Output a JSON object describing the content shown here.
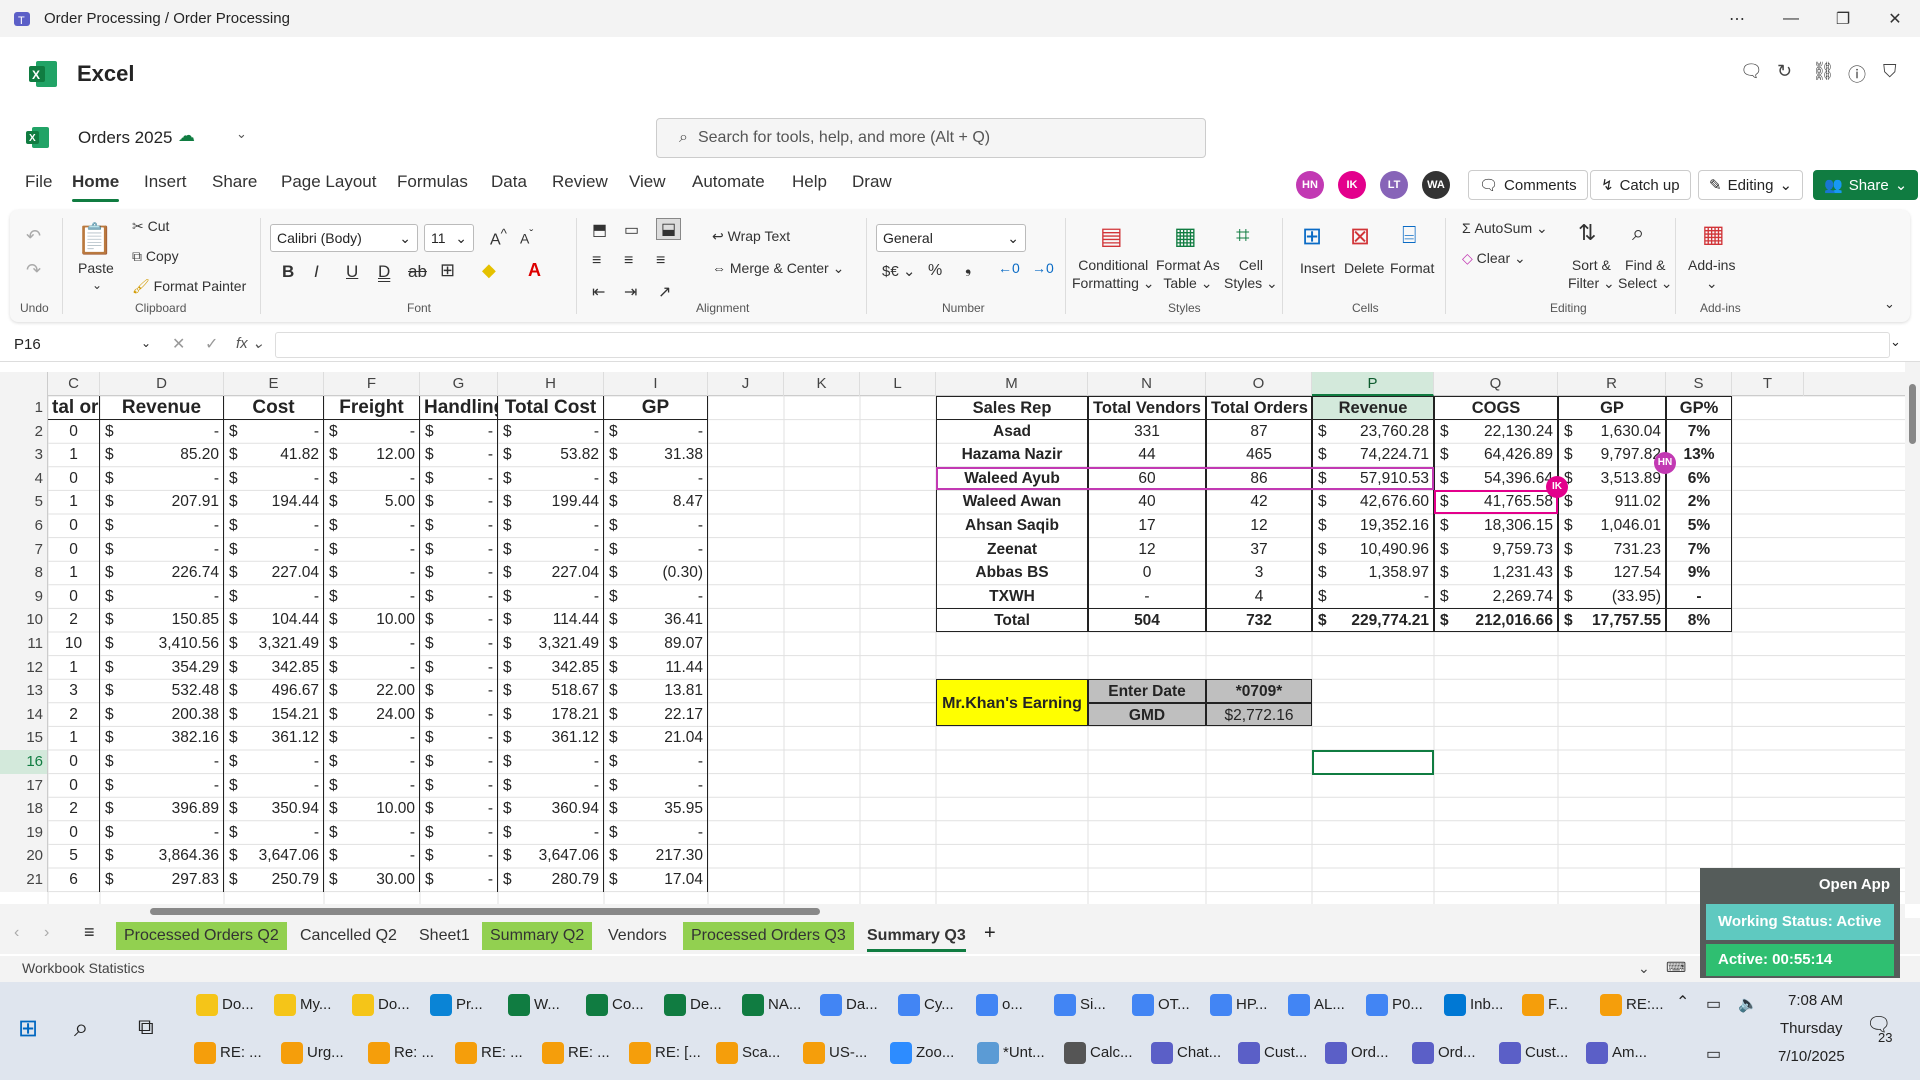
{
  "window": {
    "title": "Order Processing / Order Processing"
  },
  "app": {
    "name": "Excel",
    "doc_name": "Orders 2025"
  },
  "search": {
    "placeholder": "Search for tools, help, and more (Alt + Q)"
  },
  "tabs": [
    "File",
    "Home",
    "Insert",
    "Share",
    "Page Layout",
    "Formulas",
    "Data",
    "Review",
    "View",
    "Automate",
    "Help",
    "Draw"
  ],
  "tab_active": "Home",
  "avatars": [
    {
      "t": "HN",
      "c": "#c239b3"
    },
    {
      "t": "IK",
      "c": "#e3008c"
    },
    {
      "t": "LT",
      "c": "#8764b8"
    },
    {
      "t": "WA",
      "c": "#333333"
    }
  ],
  "actions": {
    "comments": "Comments",
    "catchup": "Catch up",
    "editing": "Editing",
    "share": "Share"
  },
  "ribbon": {
    "undo": "Undo",
    "paste": "Paste",
    "cut": "Cut",
    "copy": "Copy",
    "format_painter": "Format Painter",
    "clipboard": "Clipboard",
    "font_name": "Calibri (Body)",
    "font_size": "11",
    "font": "Font",
    "wrap": "Wrap Text",
    "merge": "Merge & Center",
    "alignment": "Alignment",
    "numfmt": "General",
    "number": "Number",
    "cond": "Conditional",
    "cond2": "Formatting",
    "fat": "Format As",
    "fat2": "Table",
    "cs": "Cell",
    "cs2": "Styles",
    "styles": "Styles",
    "insert": "Insert",
    "delete": "Delete",
    "format": "Format",
    "cells": "Cells",
    "autosum": "AutoSum",
    "clear": "Clear",
    "sort": "Sort &",
    "sort2": "Filter",
    "find": "Find &",
    "find2": "Select",
    "editing": "Editing",
    "addins": "Add-ins",
    "addins_grp": "Add-ins"
  },
  "namebox": "P16",
  "columns": [
    "C",
    "D",
    "E",
    "F",
    "G",
    "H",
    "I",
    "J",
    "K",
    "L",
    "M",
    "N",
    "O",
    "P",
    "Q",
    "R",
    "S",
    "T"
  ],
  "rows": [
    "1",
    "2",
    "3",
    "4",
    "5",
    "6",
    "7",
    "8",
    "9",
    "10",
    "11",
    "12",
    "13",
    "14",
    "15",
    "16",
    "17",
    "18",
    "19",
    "20",
    "21"
  ],
  "left_headers": [
    "tal orders",
    "Revenue",
    "Cost",
    "Freight",
    "Handling",
    "Total Cost",
    "GP"
  ],
  "left_rows": [
    [
      "0",
      "-",
      "-",
      "-",
      "-",
      "-",
      "-"
    ],
    [
      "1",
      "85.20",
      "41.82",
      "12.00",
      "-",
      "53.82",
      "31.38"
    ],
    [
      "0",
      "-",
      "-",
      "-",
      "-",
      "-",
      "-"
    ],
    [
      "1",
      "207.91",
      "194.44",
      "5.00",
      "-",
      "199.44",
      "8.47"
    ],
    [
      "0",
      "-",
      "-",
      "-",
      "-",
      "-",
      "-"
    ],
    [
      "0",
      "-",
      "-",
      "-",
      "-",
      "-",
      "-"
    ],
    [
      "1",
      "226.74",
      "227.04",
      "-",
      "-",
      "227.04",
      "(0.30)"
    ],
    [
      "0",
      "-",
      "-",
      "-",
      "-",
      "-",
      "-"
    ],
    [
      "2",
      "150.85",
      "104.44",
      "10.00",
      "-",
      "114.44",
      "36.41"
    ],
    [
      "10",
      "3,410.56",
      "3,321.49",
      "-",
      "-",
      "3,321.49",
      "89.07"
    ],
    [
      "1",
      "354.29",
      "342.85",
      "-",
      "-",
      "342.85",
      "11.44"
    ],
    [
      "3",
      "532.48",
      "496.67",
      "22.00",
      "-",
      "518.67",
      "13.81"
    ],
    [
      "2",
      "200.38",
      "154.21",
      "24.00",
      "-",
      "178.21",
      "22.17"
    ],
    [
      "1",
      "382.16",
      "361.12",
      "-",
      "-",
      "361.12",
      "21.04"
    ],
    [
      "0",
      "-",
      "-",
      "-",
      "-",
      "-",
      "-"
    ],
    [
      "0",
      "-",
      "-",
      "-",
      "-",
      "-",
      "-"
    ],
    [
      "2",
      "396.89",
      "350.94",
      "10.00",
      "-",
      "360.94",
      "35.95"
    ],
    [
      "0",
      "-",
      "-",
      "-",
      "-",
      "-",
      "-"
    ],
    [
      "5",
      "3,864.36",
      "3,647.06",
      "-",
      "-",
      "3,647.06",
      "217.30"
    ],
    [
      "6",
      "297.83",
      "250.79",
      "30.00",
      "-",
      "280.79",
      "17.04"
    ]
  ],
  "right_headers": [
    "Sales Rep",
    "Total Vendors",
    "Total Orders",
    "Revenue",
    "COGS",
    "GP",
    "GP%"
  ],
  "right_rows": [
    [
      "Asad",
      "331",
      "87",
      "23,760.28",
      "22,130.24",
      "1,630.04",
      "7%"
    ],
    [
      "Hazama Nazir",
      "44",
      "465",
      "74,224.71",
      "64,426.89",
      "9,797.82",
      "13%"
    ],
    [
      "Waleed Ayub",
      "60",
      "86",
      "57,910.53",
      "54,396.64",
      "3,513.89",
      "6%"
    ],
    [
      "Waleed Awan",
      "40",
      "42",
      "42,676.60",
      "41,765.58",
      "911.02",
      "2%"
    ],
    [
      "Ahsan Saqib",
      "17",
      "12",
      "19,352.16",
      "18,306.15",
      "1,046.01",
      "5%"
    ],
    [
      "Zeenat",
      "12",
      "37",
      "10,490.96",
      "9,759.73",
      "731.23",
      "7%"
    ],
    [
      "Abbas BS",
      "0",
      "3",
      "1,358.97",
      "1,231.43",
      "127.54",
      "9%"
    ],
    [
      "TXWH",
      "-",
      "4",
      "-",
      "2,269.74",
      "(33.95)",
      "-"
    ],
    [
      "Total",
      "504",
      "732",
      "229,774.21",
      "212,016.66",
      "17,757.55",
      "8%"
    ]
  ],
  "dollar": "$",
  "earning": {
    "label": "Mr.Khan's Earning",
    "k1": "Enter Date",
    "v1": "*0709*",
    "k2": "GMD",
    "v2": "$2,772.16"
  },
  "sheets": [
    "Processed Orders Q2",
    "Cancelled Q2",
    "Sheet1",
    "Summary Q2",
    "Vendors",
    "Processed Orders Q3",
    "Summary Q3"
  ],
  "status": "Workbook Statistics",
  "overlay": {
    "open": "Open App",
    "working": "Working Status: Active",
    "active": "Active: 00:55:14"
  },
  "taskbar_top": [
    "Do...",
    "My...",
    "Do...",
    "Pr...",
    "W...",
    "Co...",
    "De...",
    "NA...",
    "Da...",
    "Cy...",
    "o...",
    "Si...",
    "OT...",
    "HP...",
    "AL...",
    "P0...",
    "Inb...",
    "F...",
    "RE:..."
  ],
  "taskbar_bot": [
    "RE: ...",
    "Urg...",
    "Re: ...",
    "RE: ...",
    "RE: ...",
    "RE: [...",
    "Sca...",
    "US-...",
    "Zoo...",
    "*Unt...",
    "Calc...",
    "Chat...",
    "Cust...",
    "Ord...",
    "Ord...",
    "Cust...",
    "Am..."
  ],
  "clock": {
    "time": "7:08 AM",
    "day": "Thursday",
    "date": "7/10/2025",
    "badge": "23"
  }
}
